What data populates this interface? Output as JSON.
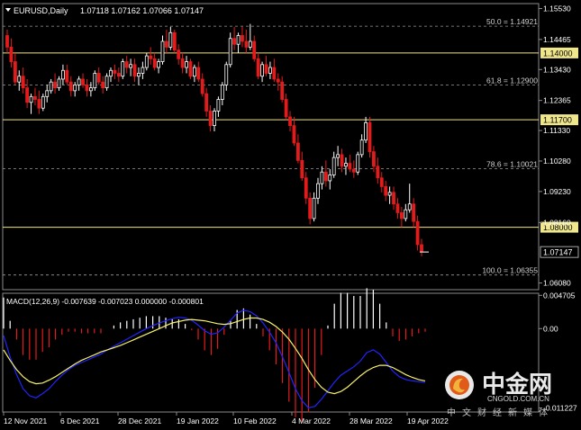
{
  "header": {
    "symbol": "EURUSD,Daily",
    "ohlc": "1.07118 1.07162 1.07066 1.07147"
  },
  "macd_header": "MACD(12,26,9) -0.007639 -0.007023 0.000000 -0.000801",
  "colors": {
    "background": "#000000",
    "bull": "#ffffff",
    "bear": "#e31b1b",
    "level_line": "#f0e68c",
    "fibo_line": "#9a9a9a",
    "macd_signal": "#f7f26a",
    "macd_line": "#2323ff",
    "hist_pos": "#ffffff",
    "hist_neg": "#e31b1b"
  },
  "watermark": {
    "brand": "中金网",
    "url": "CNGOLD.COM.CN",
    "tagline": "中文财经新媒体"
  },
  "chart_data": [
    {
      "type": "candlestick",
      "title": "EURUSD,Daily",
      "ylim": [
        1.0585,
        1.157
      ],
      "price_axis_ticks": [
        "1.15530",
        "1.14465",
        "1.13430",
        "1.12365",
        "1.11330",
        "1.10280",
        "1.09230",
        "1.08160",
        "1.07147",
        "1.06080"
      ],
      "x_tick_labels": [
        "12 Nov 2021",
        "6 Dec 2021",
        "28 Dec 2021",
        "19 Jan 2022",
        "10 Feb 2022",
        "4 Mar 2022",
        "28 Mar 2022",
        "19 Apr 2022"
      ],
      "last_price": "1.07147",
      "horizontal_levels": [
        {
          "value": 1.14,
          "label": "1.14000"
        },
        {
          "value": 1.117,
          "label": "1.11700"
        },
        {
          "value": 1.08,
          "label": "1.08000"
        }
      ],
      "fibonacci_levels": [
        {
          "value": 1.14921,
          "label": "50.0 = 1.14921"
        },
        {
          "value": 1.129,
          "label": "61.8 = 1.12900"
        },
        {
          "value": 1.10021,
          "label": "78.6 = 1.10021"
        },
        {
          "value": 1.06355,
          "label": "100.0 = 1.06355"
        }
      ],
      "ohlc": [
        [
          1.146,
          1.148,
          1.14,
          1.142
        ],
        [
          1.142,
          1.145,
          1.135,
          1.137
        ],
        [
          1.137,
          1.14,
          1.129,
          1.13
        ],
        [
          1.13,
          1.134,
          1.127,
          1.132
        ],
        [
          1.132,
          1.135,
          1.126,
          1.128
        ],
        [
          1.128,
          1.131,
          1.121,
          1.123
        ],
        [
          1.123,
          1.126,
          1.119,
          1.125
        ],
        [
          1.125,
          1.128,
          1.122,
          1.124
        ],
        [
          1.124,
          1.127,
          1.119,
          1.121
        ],
        [
          1.121,
          1.126,
          1.12,
          1.125
        ],
        [
          1.125,
          1.129,
          1.123,
          1.127
        ],
        [
          1.127,
          1.131,
          1.126,
          1.13
        ],
        [
          1.13,
          1.133,
          1.126,
          1.128
        ],
        [
          1.128,
          1.132,
          1.127,
          1.131
        ],
        [
          1.131,
          1.136,
          1.129,
          1.134
        ],
        [
          1.134,
          1.136,
          1.129,
          1.13
        ],
        [
          1.13,
          1.132,
          1.125,
          1.127
        ],
        [
          1.127,
          1.13,
          1.125,
          1.129
        ],
        [
          1.129,
          1.132,
          1.127,
          1.131
        ],
        [
          1.131,
          1.133,
          1.128,
          1.129
        ],
        [
          1.129,
          1.131,
          1.125,
          1.127
        ],
        [
          1.127,
          1.13,
          1.125,
          1.128
        ],
        [
          1.128,
          1.134,
          1.127,
          1.133
        ],
        [
          1.133,
          1.135,
          1.129,
          1.13
        ],
        [
          1.13,
          1.132,
          1.126,
          1.128
        ],
        [
          1.128,
          1.133,
          1.127,
          1.132
        ],
        [
          1.132,
          1.135,
          1.13,
          1.134
        ],
        [
          1.134,
          1.136,
          1.131,
          1.133
        ],
        [
          1.133,
          1.135,
          1.13,
          1.132
        ],
        [
          1.132,
          1.138,
          1.131,
          1.137
        ],
        [
          1.137,
          1.139,
          1.133,
          1.135
        ],
        [
          1.135,
          1.138,
          1.132,
          1.136
        ],
        [
          1.136,
          1.138,
          1.13,
          1.132
        ],
        [
          1.132,
          1.135,
          1.129,
          1.133
        ],
        [
          1.133,
          1.137,
          1.131,
          1.135
        ],
        [
          1.135,
          1.14,
          1.134,
          1.139
        ],
        [
          1.139,
          1.142,
          1.136,
          1.138
        ],
        [
          1.138,
          1.14,
          1.134,
          1.135
        ],
        [
          1.135,
          1.138,
          1.133,
          1.137
        ],
        [
          1.137,
          1.146,
          1.136,
          1.144
        ],
        [
          1.144,
          1.148,
          1.14,
          1.142
        ],
        [
          1.142,
          1.149,
          1.141,
          1.147
        ],
        [
          1.147,
          1.148,
          1.14,
          1.141
        ],
        [
          1.141,
          1.143,
          1.136,
          1.138
        ],
        [
          1.138,
          1.14,
          1.133,
          1.135
        ],
        [
          1.135,
          1.139,
          1.133,
          1.137
        ],
        [
          1.137,
          1.138,
          1.131,
          1.132
        ],
        [
          1.132,
          1.136,
          1.13,
          1.135
        ],
        [
          1.135,
          1.137,
          1.13,
          1.131
        ],
        [
          1.131,
          1.133,
          1.125,
          1.126
        ],
        [
          1.126,
          1.128,
          1.118,
          1.12
        ],
        [
          1.12,
          1.122,
          1.113,
          1.115
        ],
        [
          1.115,
          1.121,
          1.113,
          1.12
        ],
        [
          1.12,
          1.125,
          1.118,
          1.124
        ],
        [
          1.124,
          1.13,
          1.122,
          1.129
        ],
        [
          1.129,
          1.137,
          1.127,
          1.136
        ],
        [
          1.136,
          1.147,
          1.135,
          1.145
        ],
        [
          1.145,
          1.149,
          1.141,
          1.143
        ],
        [
          1.143,
          1.147,
          1.14,
          1.146
        ],
        [
          1.146,
          1.149,
          1.142,
          1.144
        ],
        [
          1.144,
          1.148,
          1.14,
          1.142
        ],
        [
          1.142,
          1.15,
          1.141,
          1.144
        ],
        [
          1.144,
          1.146,
          1.137,
          1.138
        ],
        [
          1.138,
          1.14,
          1.131,
          1.132
        ],
        [
          1.132,
          1.137,
          1.13,
          1.136
        ],
        [
          1.136,
          1.139,
          1.132,
          1.133
        ],
        [
          1.133,
          1.137,
          1.131,
          1.135
        ],
        [
          1.135,
          1.138,
          1.13,
          1.131
        ],
        [
          1.131,
          1.133,
          1.127,
          1.13
        ],
        [
          1.13,
          1.132,
          1.123,
          1.124
        ],
        [
          1.124,
          1.126,
          1.117,
          1.118
        ],
        [
          1.118,
          1.12,
          1.113,
          1.115
        ],
        [
          1.115,
          1.118,
          1.108,
          1.109
        ],
        [
          1.109,
          1.112,
          1.102,
          1.103
        ],
        [
          1.103,
          1.106,
          1.096,
          1.097
        ],
        [
          1.097,
          1.099,
          1.088,
          1.09
        ],
        [
          1.09,
          1.092,
          1.081,
          1.083
        ],
        [
          1.083,
          1.092,
          1.082,
          1.09
        ],
        [
          1.09,
          1.097,
          1.088,
          1.095
        ],
        [
          1.095,
          1.101,
          1.093,
          1.099
        ],
        [
          1.099,
          1.103,
          1.094,
          1.096
        ],
        [
          1.096,
          1.1,
          1.093,
          1.098
        ],
        [
          1.098,
          1.106,
          1.097,
          1.104
        ],
        [
          1.104,
          1.108,
          1.101,
          1.105
        ],
        [
          1.105,
          1.107,
          1.099,
          1.101
        ],
        [
          1.101,
          1.104,
          1.098,
          1.102
        ],
        [
          1.102,
          1.105,
          1.099,
          1.1
        ],
        [
          1.1,
          1.103,
          1.097,
          1.099
        ],
        [
          1.099,
          1.106,
          1.098,
          1.105
        ],
        [
          1.105,
          1.112,
          1.104,
          1.11
        ],
        [
          1.11,
          1.118,
          1.109,
          1.116
        ],
        [
          1.116,
          1.118,
          1.104,
          1.106
        ],
        [
          1.106,
          1.108,
          1.099,
          1.101
        ],
        [
          1.101,
          1.104,
          1.095,
          1.097
        ],
        [
          1.097,
          1.099,
          1.092,
          1.094
        ],
        [
          1.094,
          1.096,
          1.089,
          1.091
        ],
        [
          1.091,
          1.094,
          1.088,
          1.092
        ],
        [
          1.092,
          1.094,
          1.086,
          1.088
        ],
        [
          1.088,
          1.09,
          1.083,
          1.085
        ],
        [
          1.085,
          1.087,
          1.08,
          1.083
        ],
        [
          1.083,
          1.088,
          1.082,
          1.086
        ],
        [
          1.086,
          1.095,
          1.085,
          1.088
        ],
        [
          1.088,
          1.09,
          1.08,
          1.082
        ],
        [
          1.082,
          1.084,
          1.072,
          1.074
        ],
        [
          1.074,
          1.076,
          1.07,
          1.07147
        ]
      ]
    },
    {
      "type": "macd",
      "title": "MACD(12,26,9)",
      "params": [
        12,
        26,
        9
      ],
      "values": {
        "macd": -0.007639,
        "signal": -0.007023,
        "third": 0.0,
        "histogram": -0.000801
      },
      "ylim": [
        -0.0118,
        0.005
      ],
      "axis_ticks": [
        "0.004705",
        "0.00",
        "-0.011227"
      ],
      "x_tick_labels": [
        "12 Nov 2021",
        "6 Dec 2021",
        "28 Dec 2021",
        "19 Jan 2022",
        "10 Feb 2022",
        "4 Mar 2022",
        "28 Mar 2022",
        "19 Apr 2022"
      ],
      "signal": [
        -0.003,
        -0.0045,
        -0.0058,
        -0.0068,
        -0.0075,
        -0.0078,
        -0.0077,
        -0.0073,
        -0.0068,
        -0.0062,
        -0.0056,
        -0.005,
        -0.0045,
        -0.0041,
        -0.0037,
        -0.0033,
        -0.003,
        -0.0027,
        -0.0024,
        -0.002,
        -0.0016,
        -0.0012,
        -0.0008,
        -0.0004,
        0.0,
        0.0004,
        0.0008,
        0.001,
        0.0012,
        0.0013,
        0.0012,
        0.0011,
        0.0009,
        0.0007,
        0.0006,
        0.0007,
        0.001,
        0.0013,
        0.0015,
        0.0015,
        0.0013,
        0.0009,
        0.0003,
        -0.0005,
        -0.0015,
        -0.0028,
        -0.0042,
        -0.0058,
        -0.0072,
        -0.0083,
        -0.009,
        -0.0092,
        -0.0089,
        -0.0083,
        -0.0075,
        -0.0067,
        -0.006,
        -0.0055,
        -0.0052,
        -0.0052,
        -0.0055,
        -0.006,
        -0.0065,
        -0.0069,
        -0.0072,
        -0.0074
      ],
      "macd": [
        -0.001,
        -0.004,
        -0.0065,
        -0.0085,
        -0.0095,
        -0.0098,
        -0.0092,
        -0.0085,
        -0.0075,
        -0.0066,
        -0.0058,
        -0.0052,
        -0.0048,
        -0.0044,
        -0.004,
        -0.0036,
        -0.003,
        -0.0025,
        -0.002,
        -0.0015,
        -0.001,
        -0.0005,
        0.0,
        0.0004,
        0.0008,
        0.0011,
        0.0014,
        0.0016,
        0.0015,
        0.0012,
        0.0005,
        -0.0003,
        -0.0008,
        -0.0006,
        0.0002,
        0.0012,
        0.0022,
        0.0026,
        0.0024,
        0.0018,
        0.0008,
        -0.0005,
        -0.002,
        -0.004,
        -0.0062,
        -0.0085,
        -0.0102,
        -0.0112,
        -0.011,
        -0.01,
        -0.0088,
        -0.0076,
        -0.0066,
        -0.006,
        -0.0054,
        -0.0046,
        -0.0034,
        -0.003,
        -0.0036,
        -0.0048,
        -0.006,
        -0.0068,
        -0.0072,
        -0.0074,
        -0.0075,
        -0.0076
      ]
    }
  ]
}
